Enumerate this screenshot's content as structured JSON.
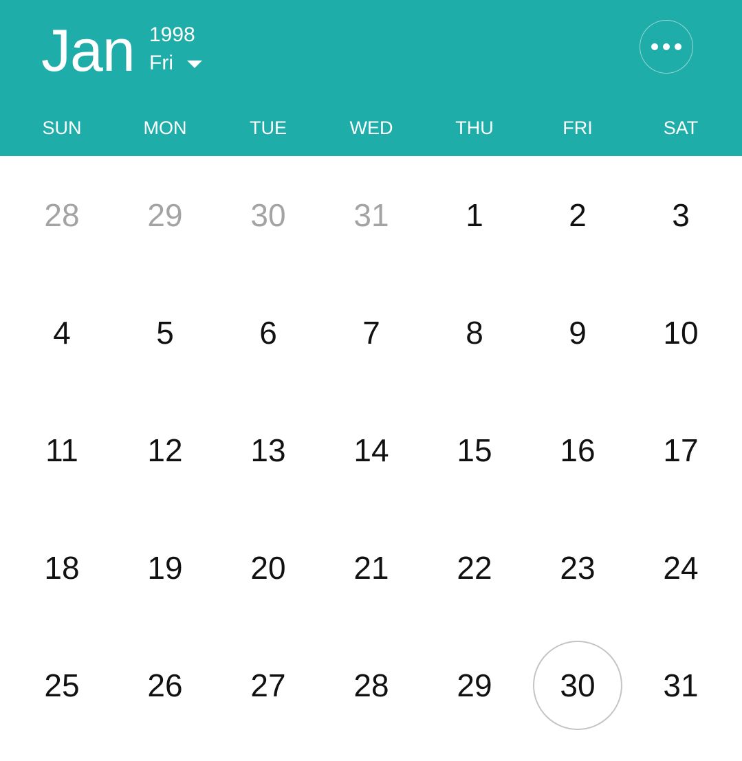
{
  "header": {
    "month": "Jan",
    "year": "1998",
    "weekday": "Fri",
    "more_icon": "more-horizontal-icon",
    "background_color": "#1fada9"
  },
  "weekdays": [
    "SUN",
    "MON",
    "TUE",
    "WED",
    "THU",
    "FRI",
    "SAT"
  ],
  "weeks": [
    [
      {
        "d": "28",
        "muted": true
      },
      {
        "d": "29",
        "muted": true
      },
      {
        "d": "30",
        "muted": true
      },
      {
        "d": "31",
        "muted": true
      },
      {
        "d": "1"
      },
      {
        "d": "2"
      },
      {
        "d": "3"
      }
    ],
    [
      {
        "d": "4"
      },
      {
        "d": "5"
      },
      {
        "d": "6"
      },
      {
        "d": "7"
      },
      {
        "d": "8"
      },
      {
        "d": "9"
      },
      {
        "d": "10"
      }
    ],
    [
      {
        "d": "11"
      },
      {
        "d": "12"
      },
      {
        "d": "13"
      },
      {
        "d": "14"
      },
      {
        "d": "15"
      },
      {
        "d": "16"
      },
      {
        "d": "17"
      }
    ],
    [
      {
        "d": "18"
      },
      {
        "d": "19"
      },
      {
        "d": "20"
      },
      {
        "d": "21"
      },
      {
        "d": "22"
      },
      {
        "d": "23"
      },
      {
        "d": "24"
      }
    ],
    [
      {
        "d": "25"
      },
      {
        "d": "26"
      },
      {
        "d": "27"
      },
      {
        "d": "28"
      },
      {
        "d": "29"
      },
      {
        "d": "30",
        "today": true
      },
      {
        "d": "31"
      }
    ]
  ]
}
